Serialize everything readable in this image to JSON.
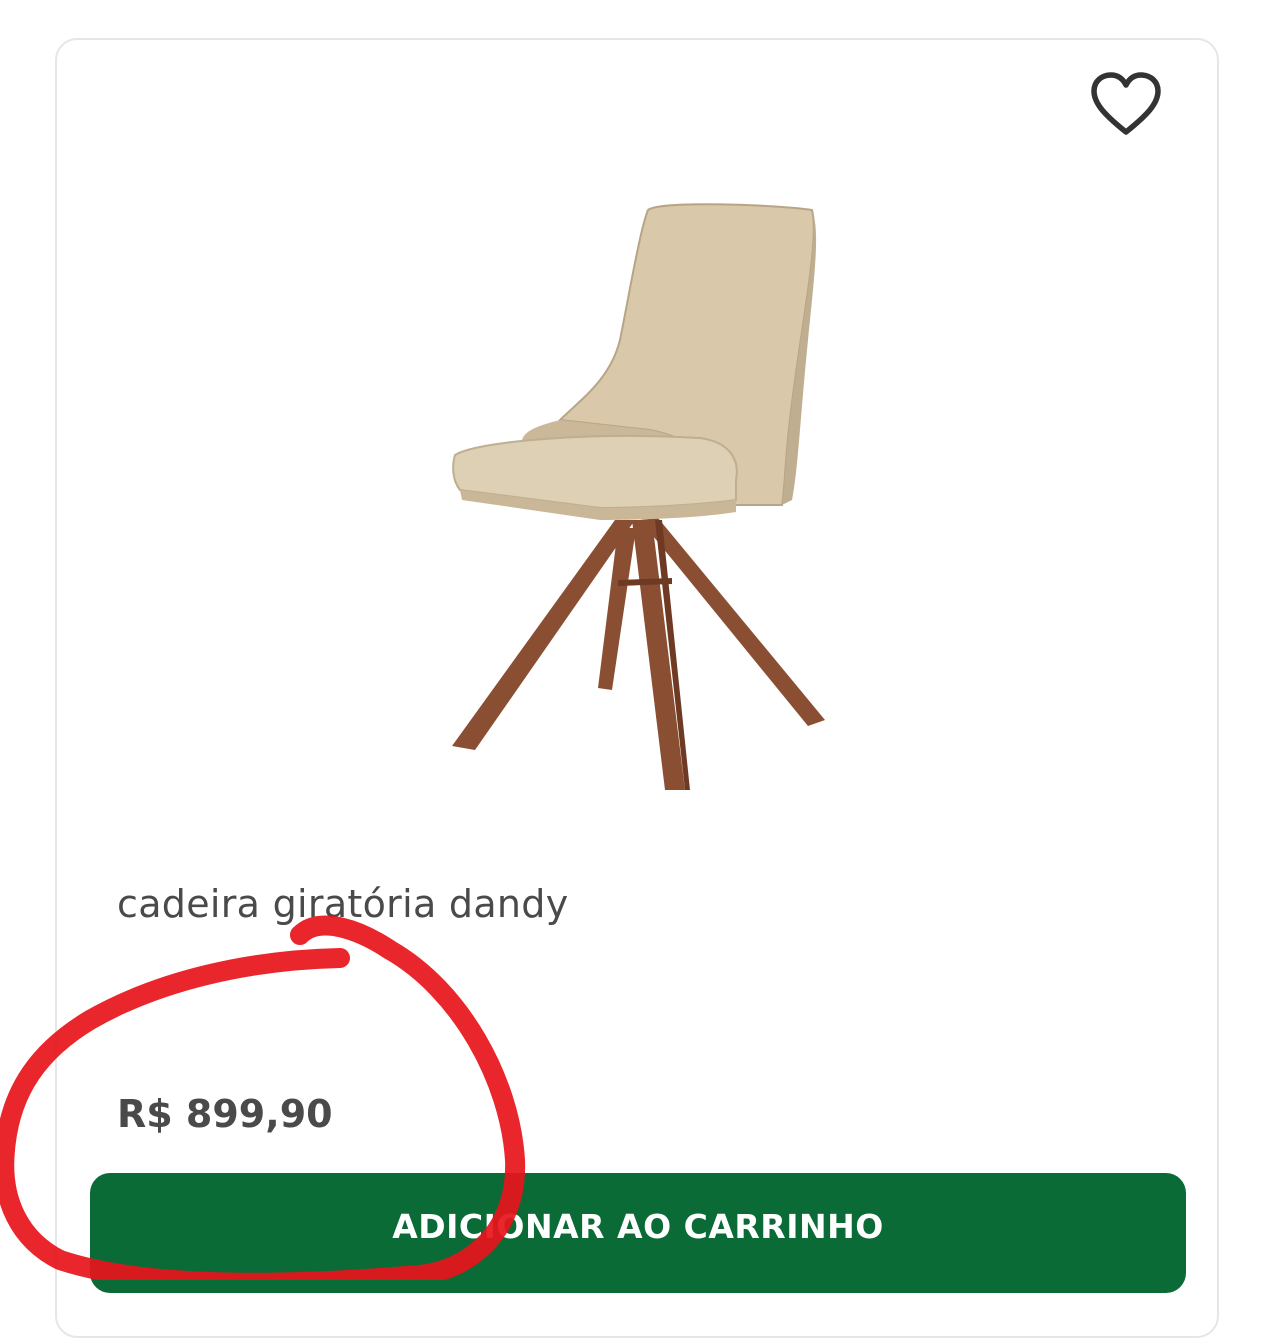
{
  "product": {
    "title": "cadeira giratória dandy",
    "price": "R$ 899,90",
    "image_description": "beige upholstered swivel chair with wooden legs"
  },
  "actions": {
    "add_to_cart_label": "ADICIONAR AO CARRINHO",
    "favorite_icon": "heart-outline-icon"
  },
  "colors": {
    "button_green": "#0b6b37",
    "annotation_red": "#e8141b",
    "text_gray": "#4a4a4a"
  }
}
